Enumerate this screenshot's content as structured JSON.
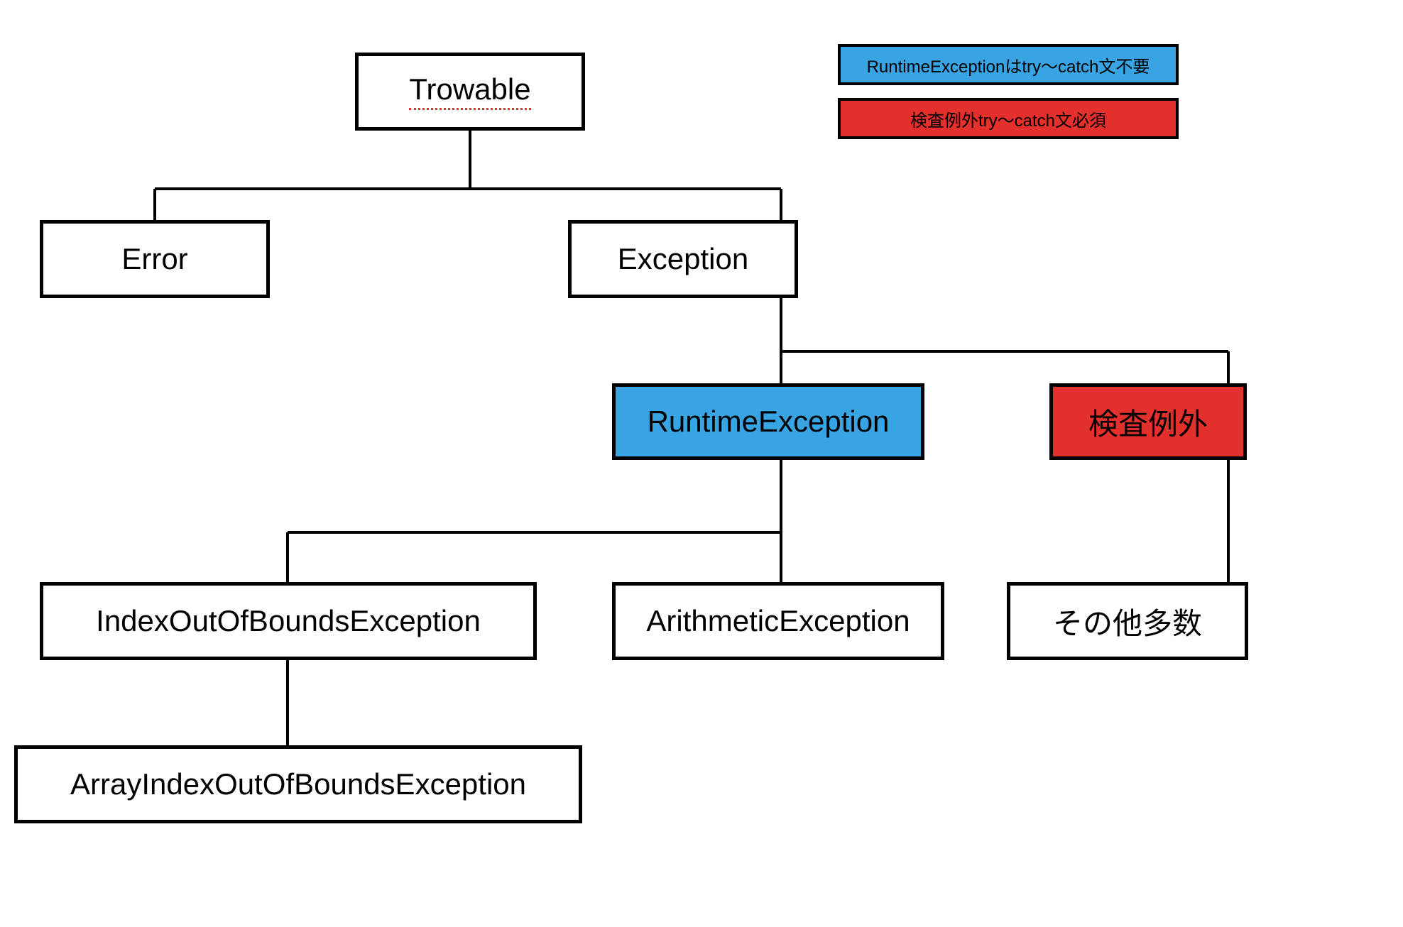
{
  "legend": {
    "blue": "RuntimeExceptionはtry〜catch文不要",
    "red": "検査例外try〜catch文必須"
  },
  "nodes": {
    "throwable": "Trowable",
    "error": "Error",
    "exception": "Exception",
    "runtime": "RuntimeException",
    "checked": "検査例外",
    "ioob": "IndexOutOfBoundsException",
    "arith": "ArithmeticException",
    "others": "その他多数",
    "aioob": "ArrayIndexOutOfBoundsException"
  },
  "colors": {
    "blue": "#38a4e3",
    "red": "#e3302c",
    "border": "#000000",
    "background": "#ffffff"
  }
}
